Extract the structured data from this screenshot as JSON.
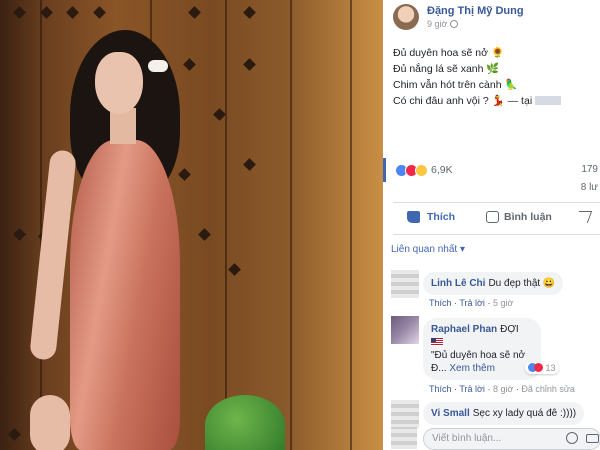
{
  "post": {
    "author": "Đặng Thị Mỹ Dung",
    "time": "9 giờ",
    "caption_lines": [
      "Đủ duyên hoa sẽ nở 🌻",
      "Đủ nắng lá sẽ xanh 🌿",
      "Chim vẫn hót trên cành 🦜",
      "Có chi đâu anh vội ? 💃 — tại"
    ],
    "reaction_count": "6,9K",
    "reactions_right": "179",
    "shares_right": "8 lư"
  },
  "actions": {
    "like": "Thích",
    "comment": "Bình luận"
  },
  "filter": "Liên quan nhất ▾",
  "comments": [
    {
      "name": "Linh Lê Chi",
      "text": "Du đẹp thật 😀",
      "actions": [
        "Thích",
        "Trả lời",
        "5 giờ"
      ]
    },
    {
      "name": "Raphael Phan",
      "badge": "ĐỢI",
      "text_lines": [
        "\"Đủ duyên hoa sẽ nở",
        "Đ..."
      ],
      "see_more": "Xem thêm",
      "reaction_count": "13",
      "actions": [
        "Thích",
        "Trả lời",
        "8 giờ",
        "Đã chỉnh sửa"
      ]
    },
    {
      "name": "Vi Small",
      "text": "Sẹc xy lady quá đê :))))"
    }
  ],
  "composer": {
    "placeholder": "Viết bình luận..."
  },
  "colors": {
    "link": "#385898",
    "accent": "#4267b2",
    "bubble": "#f2f3f5"
  }
}
